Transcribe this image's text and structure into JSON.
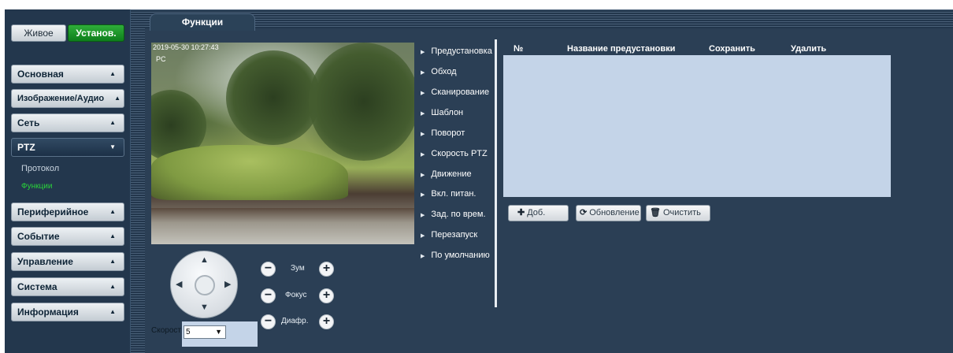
{
  "mode": {
    "live_label": "Живое",
    "setup_label": "Установ."
  },
  "sidebar": {
    "items": [
      {
        "label": "Основная",
        "arrow": "▲"
      },
      {
        "label": "Изображение/Аудио",
        "arrow": "▲"
      },
      {
        "label": "Сеть",
        "arrow": "▲"
      },
      {
        "label": "PTZ",
        "arrow": "▼"
      },
      {
        "label": "Периферийное",
        "arrow": "▲"
      },
      {
        "label": "Событие",
        "arrow": "▲"
      },
      {
        "label": "Управление",
        "arrow": "▲"
      },
      {
        "label": "Система",
        "arrow": "▲"
      },
      {
        "label": "Информация",
        "arrow": "▲"
      }
    ],
    "ptz_sub": [
      {
        "label": "Протокол"
      },
      {
        "label": "Функции"
      }
    ]
  },
  "tab": {
    "label": "Функции"
  },
  "video": {
    "timestamp": "2019-05-30 10:27:43",
    "channel": "PC"
  },
  "ptz": {
    "zoom_label": "Зум",
    "focus_label": "Фокус",
    "iris_label": "Диафр.",
    "speed_label": "Скорост",
    "speed_value": "5"
  },
  "functions": [
    "Предустановка",
    "Обход",
    "Сканирование",
    "Шаблон",
    "Поворот",
    "Скорость PTZ",
    "Движение",
    "Вкл. питан.",
    "Зад. по врем.",
    "Перезапуск",
    "По умолчанию"
  ],
  "preset_table": {
    "columns": [
      "№",
      "Название предустановки",
      "Сохранить",
      "Удалить"
    ],
    "rows": []
  },
  "actions": {
    "add": "Доб.",
    "refresh": "Обновление",
    "clear": "Очистить"
  },
  "colors": {
    "accent_active": "#0e7e1b",
    "current_item": "#29d23a",
    "table_bg": "#c4d4e8",
    "panel_bg": "#2b3f55"
  }
}
